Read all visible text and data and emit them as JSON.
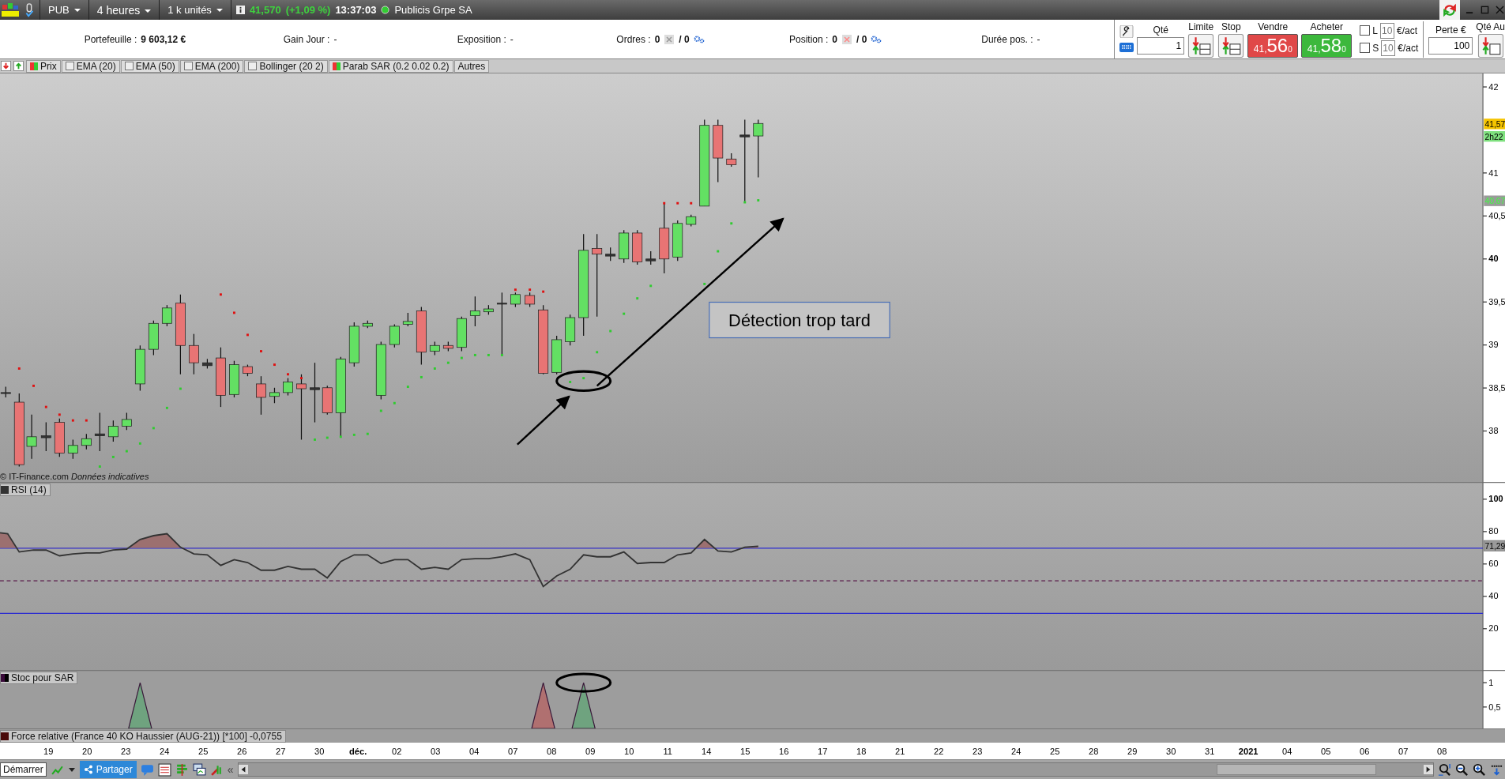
{
  "toolbar": {
    "symbol": "PUB",
    "period": "4 heures",
    "units": "1 k unités",
    "last_price": "41,570",
    "change": "(+1,09 %)",
    "time": "13:37:03",
    "instrument": "Publicis Grpe SA"
  },
  "account": [
    {
      "label": "Portefeuille :",
      "value": "9 603,12 €",
      "kind": "plain"
    },
    {
      "label": "Gain Jour :",
      "value": "-",
      "kind": "plain"
    },
    {
      "label": "Exposition :",
      "value": "-",
      "kind": "plain"
    },
    {
      "label": "Ordres :",
      "value": "0",
      "value2": "/ 0",
      "kind": "counts"
    },
    {
      "label": "Position :",
      "value": "0",
      "value2": "/ 0",
      "kind": "counts"
    },
    {
      "label": "Durée pos. :",
      "value": "-",
      "kind": "plain"
    }
  ],
  "order_panel": {
    "qty_label": "Qté",
    "qty": "1",
    "limit_label": "Limite",
    "stop_label": "Stop",
    "sell": {
      "label": "Vendre",
      "price_small": "41,",
      "price_big": "56",
      "price_sup": "0"
    },
    "buy": {
      "label": "Acheter",
      "price_small": "41,",
      "price_big": "58",
      "price_sup": "0"
    },
    "sides": [
      {
        "label": "L",
        "checked": false,
        "placeholder": "10",
        "unit": "€/act"
      },
      {
        "label": "S",
        "checked": false,
        "placeholder": "10",
        "unit": "€/act"
      }
    ],
    "loss_label": "Perte €",
    "loss": "100",
    "auto_qty_label": "Qté Au"
  },
  "indicators": [
    {
      "label": "Prix",
      "kind": "swatch"
    },
    {
      "label": "EMA (20)",
      "kind": "checkbox",
      "checked": false
    },
    {
      "label": "EMA (50)",
      "kind": "checkbox",
      "checked": false
    },
    {
      "label": "EMA (200)",
      "kind": "checkbox",
      "checked": false
    },
    {
      "label": "Bollinger (20 2)",
      "kind": "checkbox",
      "checked": false
    },
    {
      "label": "Parab SAR (0.2 0.02 0.2)",
      "kind": "swatch"
    },
    {
      "label": "Autres",
      "kind": "plain"
    }
  ],
  "price_chart": {
    "y_ticks": [
      {
        "label": "42",
        "bold": false
      },
      {
        "label": "41",
        "bold": false
      },
      {
        "label": "40,5",
        "bold": false
      },
      {
        "label": "40",
        "bold": true
      },
      {
        "label": "39,5",
        "bold": false
      },
      {
        "label": "39",
        "bold": false
      },
      {
        "label": "38,5",
        "bold": false
      },
      {
        "label": "38",
        "bold": false
      }
    ],
    "badges": [
      {
        "label": "41,57",
        "kind": "last"
      },
      {
        "label": "2h22",
        "kind": "timer"
      },
      {
        "label": "40,67",
        "kind": "sar"
      }
    ],
    "annotation": "Détection trop tard",
    "credit": "© IT-Finance.com",
    "credit_note": "Données indicatives"
  },
  "rsi": {
    "label": "RSI (14)",
    "y_ticks": [
      {
        "label": "100",
        "bold": true
      },
      {
        "label": "80",
        "bold": false
      },
      {
        "label": "60",
        "bold": false
      },
      {
        "label": "40",
        "bold": false
      },
      {
        "label": "20",
        "bold": false
      }
    ],
    "badge": "71,29"
  },
  "stoc": {
    "label": "Stoc pour SAR",
    "y_ticks": [
      {
        "label": "1",
        "bold": false
      },
      {
        "label": "0,5",
        "bold": false
      }
    ]
  },
  "force": {
    "label": "Force relative (France 40 KO Haussier (AUG-21)) [*100] -0,0755"
  },
  "dates": [
    {
      "label": "19",
      "bold": false
    },
    {
      "label": "20",
      "bold": false
    },
    {
      "label": "23",
      "bold": false
    },
    {
      "label": "24",
      "bold": false
    },
    {
      "label": "25",
      "bold": false
    },
    {
      "label": "26",
      "bold": false
    },
    {
      "label": "27",
      "bold": false
    },
    {
      "label": "30",
      "bold": false
    },
    {
      "label": "déc.",
      "bold": true
    },
    {
      "label": "02",
      "bold": false
    },
    {
      "label": "03",
      "bold": false
    },
    {
      "label": "04",
      "bold": false
    },
    {
      "label": "07",
      "bold": false
    },
    {
      "label": "08",
      "bold": false
    },
    {
      "label": "09",
      "bold": false
    },
    {
      "label": "10",
      "bold": false
    },
    {
      "label": "11",
      "bold": false
    },
    {
      "label": "14",
      "bold": false
    },
    {
      "label": "15",
      "bold": false
    },
    {
      "label": "16",
      "bold": false
    },
    {
      "label": "17",
      "bold": false
    },
    {
      "label": "18",
      "bold": false
    },
    {
      "label": "21",
      "bold": false
    },
    {
      "label": "22",
      "bold": false
    },
    {
      "label": "23",
      "bold": false
    },
    {
      "label": "24",
      "bold": false
    },
    {
      "label": "25",
      "bold": false
    },
    {
      "label": "28",
      "bold": false
    },
    {
      "label": "29",
      "bold": false
    },
    {
      "label": "30",
      "bold": false
    },
    {
      "label": "31",
      "bold": false
    },
    {
      "label": "2021",
      "bold": true
    },
    {
      "label": "04",
      "bold": false
    },
    {
      "label": "05",
      "bold": false
    },
    {
      "label": "06",
      "bold": false
    },
    {
      "label": "07",
      "bold": false
    },
    {
      "label": "08",
      "bold": false
    }
  ],
  "bottom_bar": {
    "start": "Démarrer",
    "share": "Partager",
    "collapse": "«"
  }
}
